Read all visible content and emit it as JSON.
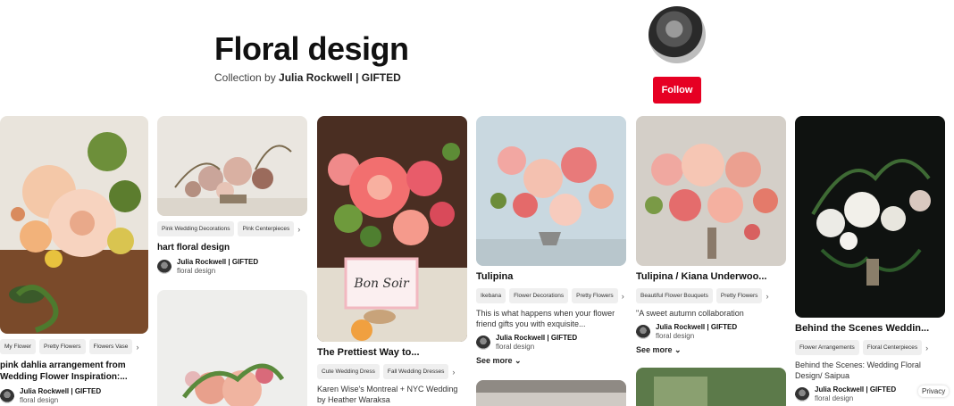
{
  "board": {
    "title": "Floral design",
    "subtitle_prefix": "Collection by",
    "owner": "Julia Rockwell | GIFTED",
    "follow_label": "Follow"
  },
  "pins": {
    "p1": {
      "chips": [
        "My Flower",
        "Pretty Flowers",
        "Flowers Vase"
      ],
      "title": "pink dahlia arrangement from Wedding Flower Inspiration:...",
      "user": "Julia Rockwell | GIFTED",
      "board": "floral design"
    },
    "p2": {
      "chips": [
        "Pink Wedding Decorations",
        "Pink Centerpieces"
      ],
      "title": "hart floral design",
      "user": "Julia Rockwell | GIFTED",
      "board": "floral design"
    },
    "p3": {
      "chips": [
        "Cute Wedding Dress",
        "Fall Wedding Dresses"
      ],
      "title": "The Prettiest Way to...",
      "desc": "Karen Wise's Montreal + NYC Wedding by Heather Waraksa",
      "card_text": "Bon Soir"
    },
    "p4": {
      "chips": [
        "Ikebana",
        "Flower Decorations",
        "Pretty Flowers"
      ],
      "title": "Tulipina",
      "desc": "This is what happens when your flower friend gifts you with exquisite...",
      "user": "Julia Rockwell | GIFTED",
      "board": "floral design",
      "see_more": "See more"
    },
    "p5": {
      "chips": [
        "Beautiful Flower Bouquets",
        "Pretty Flowers"
      ],
      "title": "Tulipina / Kiana Underwoo...",
      "desc": "\"A sweet autumn collaboration",
      "user": "Julia Rockwell | GIFTED",
      "board": "floral design",
      "see_more": "See more"
    },
    "p6": {
      "chips": [
        "Flower Arrangements",
        "Floral Centerpieces"
      ],
      "title": "Behind the Scenes Weddin...",
      "desc": "Behind the Scenes: Wedding Floral Design/ Saipua",
      "user": "Julia Rockwell | GIFTED",
      "board": "floral design"
    }
  },
  "privacy_label": "Privacy",
  "colors": {
    "follow": "#e60023",
    "chip_bg": "#efefef"
  }
}
